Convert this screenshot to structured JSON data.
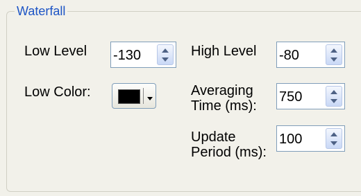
{
  "group": {
    "title": "Waterfall"
  },
  "low_level": {
    "label": "Low Level",
    "value": "-130"
  },
  "high_level": {
    "label": "High Level",
    "value": "-80"
  },
  "low_color": {
    "label": "Low Color:",
    "color": "#000000"
  },
  "averaging_time": {
    "label": "Averaging Time (ms):",
    "value": "750"
  },
  "update_period": {
    "label": "Update Period (ms):",
    "value": "100"
  },
  "colors": {
    "group_title": "#1c54c5",
    "background": "#f2f1ea",
    "spin_border": "#7f9db9"
  }
}
